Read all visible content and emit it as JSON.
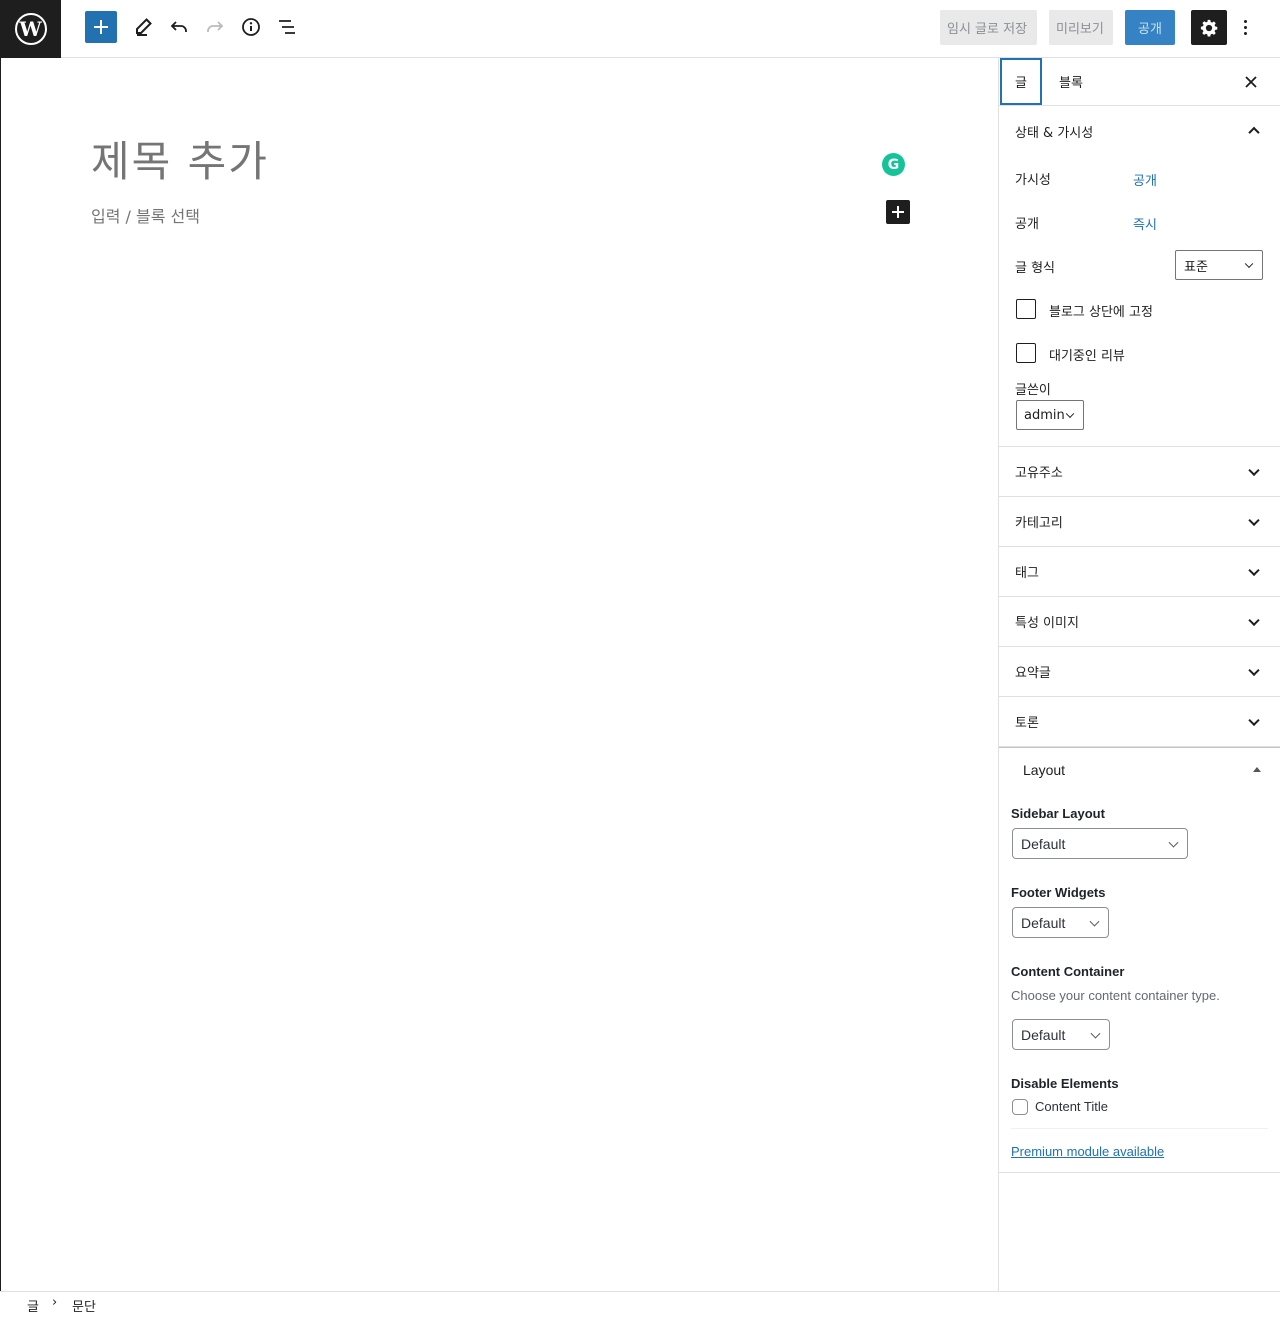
{
  "toolbar": {
    "save_draft": "임시 글로 저장",
    "preview": "미리보기",
    "publish": "공개"
  },
  "editor": {
    "title_placeholder": "제목 추가",
    "block_placeholder": "입력 / 블록 선택"
  },
  "sidebar": {
    "tabs": [
      "글",
      "블록"
    ],
    "status": {
      "heading": "상태 & 가시성",
      "visibility_label": "가시성",
      "visibility_value": "공개",
      "publish_label": "공개",
      "publish_value": "즉시",
      "format_label": "글 형식",
      "format_value": "표준",
      "sticky_label": "블로그 상단에 고정",
      "pending_label": "대기중인 리뷰",
      "author_label": "글쓴이",
      "author_value": "admin"
    },
    "panels": [
      "고유주소",
      "카테고리",
      "태그",
      "특성 이미지",
      "요약글",
      "토론"
    ],
    "layout": {
      "title": "Layout",
      "sidebar_layout_label": "Sidebar Layout",
      "sidebar_layout_value": "Default",
      "footer_widgets_label": "Footer Widgets",
      "footer_widgets_value": "Default",
      "content_container_label": "Content Container",
      "content_container_desc": "Choose your content container type.",
      "content_container_value": "Default",
      "disable_elements_label": "Disable Elements",
      "content_title_label": "Content Title",
      "premium_link": "Premium module available"
    }
  },
  "footer": {
    "breadcrumb": [
      "글",
      "문단"
    ]
  }
}
